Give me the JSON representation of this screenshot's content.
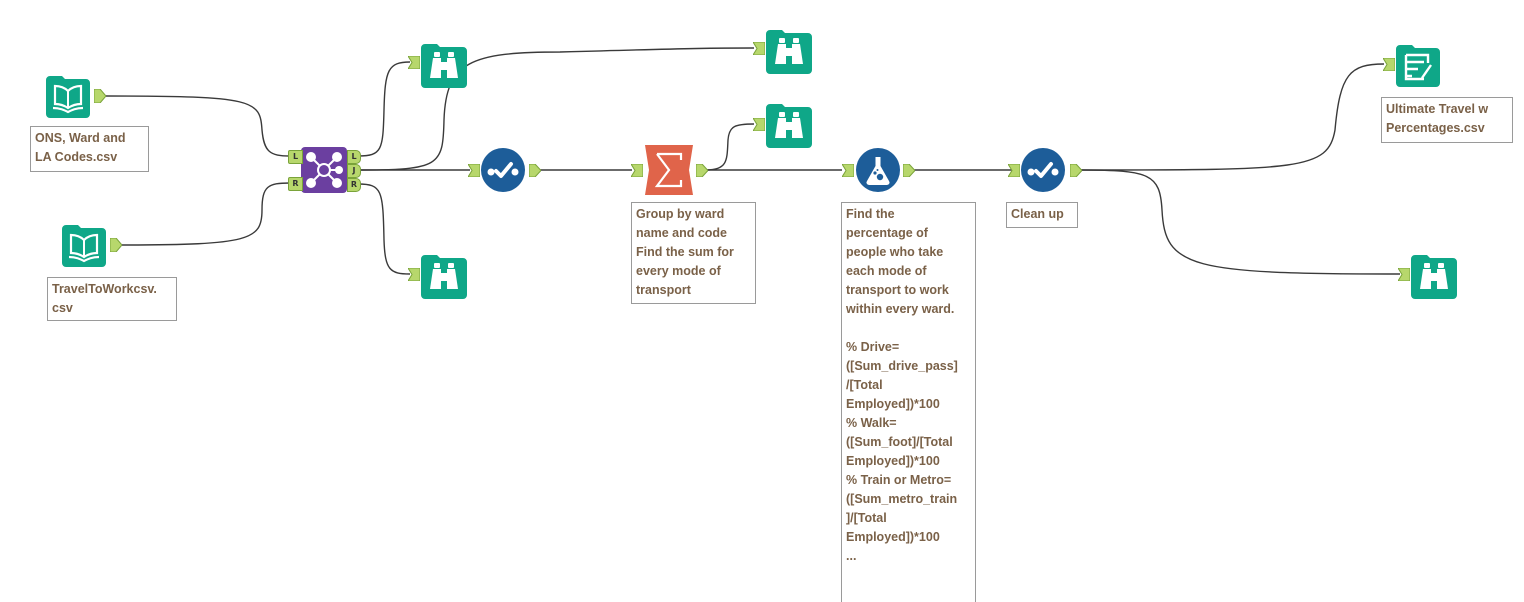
{
  "canvas": {
    "colors": {
      "in_out_teal": "#0fa788",
      "browse_teal": "#0fa788",
      "join_purple": "#6b3fa0",
      "prep_blue": "#1d5d99",
      "summarize_orange": "#e0644a",
      "anchor_green": "#b7d76c",
      "wire": "#3a3a3a",
      "annotation_text": "#7a6148"
    },
    "tools": [
      {
        "id": "input-ons",
        "type": "input-data",
        "icon": "book-icon",
        "annotation": "ONS, Ward and\nLA Codes.csv"
      },
      {
        "id": "input-travel",
        "type": "input-data",
        "icon": "book-icon",
        "annotation": "TravelToWorkcsv.\ncsv"
      },
      {
        "id": "join",
        "type": "join",
        "icon": "join-icon",
        "input_anchors": [
          "L",
          "R"
        ],
        "output_anchors": [
          "L",
          "J",
          "R"
        ]
      },
      {
        "id": "browse-left",
        "type": "browse",
        "icon": "binoculars-icon"
      },
      {
        "id": "browse-right",
        "type": "browse",
        "icon": "binoculars-icon"
      },
      {
        "id": "browse-join",
        "type": "browse",
        "icon": "binoculars-icon"
      },
      {
        "id": "select-1",
        "type": "select",
        "icon": "check-icon"
      },
      {
        "id": "summarize",
        "type": "summarize",
        "icon": "sigma-icon",
        "annotation": "Group by ward\nname and code\nFind the sum for\nevery mode of\ntransport"
      },
      {
        "id": "browse-summarize",
        "type": "browse",
        "icon": "binoculars-icon"
      },
      {
        "id": "formula",
        "type": "formula",
        "icon": "flask-icon",
        "annotation": "Find the\npercentage of\npeople who take\neach mode of\ntransport to work\nwithin every ward.\n\n% Drive=\n([Sum_drive_pass]\n/[Total\nEmployed])*100\n% Walk=\n([Sum_foot]/[Total\nEmployed])*100\n% Train or Metro=\n([Sum_metro_train\n]/[Total\nEmployed])*100\n..."
      },
      {
        "id": "select-2",
        "type": "select",
        "icon": "check-icon",
        "annotation": "Clean up"
      },
      {
        "id": "output",
        "type": "output-data",
        "icon": "output-file-icon",
        "annotation": "Ultimate Travel w\nPercentages.csv"
      },
      {
        "id": "browse-final",
        "type": "browse",
        "icon": "binoculars-icon"
      }
    ],
    "connections": [
      [
        "input-ons",
        "join.L"
      ],
      [
        "input-travel",
        "join.R"
      ],
      [
        "join.L",
        "browse-left"
      ],
      [
        "join.J",
        "browse-join"
      ],
      [
        "join.J",
        "select-1"
      ],
      [
        "join.R",
        "browse-right"
      ],
      [
        "select-1",
        "summarize"
      ],
      [
        "summarize",
        "browse-summarize"
      ],
      [
        "summarize",
        "formula"
      ],
      [
        "formula",
        "select-2"
      ],
      [
        "select-2",
        "output"
      ],
      [
        "select-2",
        "browse-final"
      ]
    ]
  },
  "labels": {
    "join_in_L": "L",
    "join_in_R": "R",
    "join_out_L": "L",
    "join_out_J": "J",
    "join_out_R": "R",
    "ann_input_ons": "ONS, Ward and\nLA Codes.csv",
    "ann_input_travel": "TravelToWorkcsv.\ncsv",
    "ann_summarize": "Group by ward\nname and code\nFind the sum for\nevery mode of\ntransport",
    "ann_formula": "Find the\npercentage of\npeople who take\neach mode of\ntransport to work\nwithin every ward.\n\n% Drive=\n([Sum_drive_pass]\n/[Total\nEmployed])*100\n% Walk=\n([Sum_foot]/[Total\nEmployed])*100\n% Train or Metro=\n([Sum_metro_train\n]/[Total\nEmployed])*100\n...",
    "ann_select2": "Clean up",
    "ann_output": "Ultimate Travel w\nPercentages.csv"
  }
}
